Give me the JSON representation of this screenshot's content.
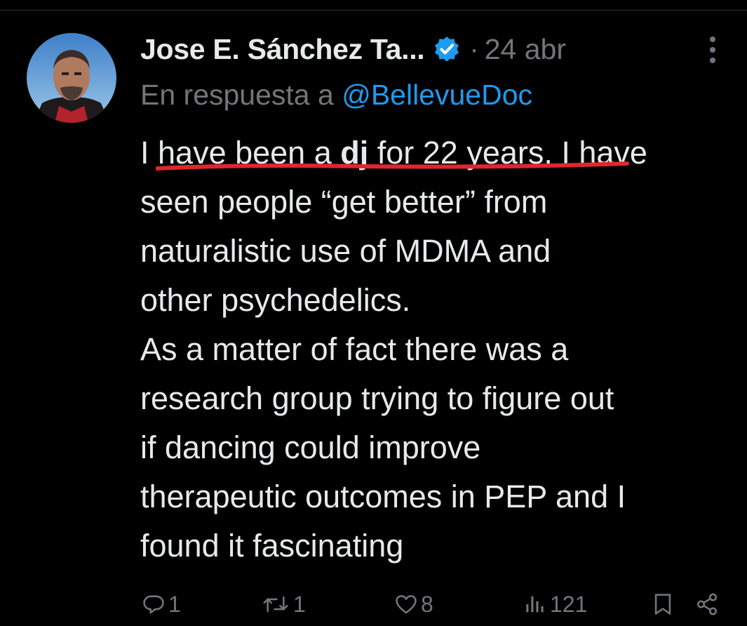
{
  "post": {
    "author_name": "Jose E. Sánchez Ta...",
    "separator": "·",
    "date": "24 abr",
    "reply_prefix": "En respuesta a",
    "reply_handle": "@BellevueDoc",
    "body_lines": [
      [
        "I ",
        "have been a ",
        "dj",
        " for 22 years.",
        " I have"
      ],
      "seen people “get better” from",
      "naturalistic use of MDMA and",
      "other psychedelics.",
      "As a matter of fact there was a",
      "research group trying to figure out",
      "if dancing could improve",
      "therapeutic outcomes in PEP and I",
      "found it fascinating"
    ],
    "highlight_color": "#e0262e"
  },
  "actions": {
    "reply_count": "1",
    "repost_count": "1",
    "like_count": "8",
    "view_count": "121"
  },
  "icons": {
    "verified": "verified-badge-icon",
    "more": "more-options-icon",
    "reply": "reply-icon",
    "repost": "repost-icon",
    "like": "heart-icon",
    "views": "views-chart-icon",
    "bookmark": "bookmark-icon",
    "share": "share-icon"
  },
  "colors": {
    "background": "#000000",
    "text": "#e7e9ea",
    "muted": "#71767b",
    "link": "#1d9bf0",
    "verified": "#1d9bf0"
  }
}
